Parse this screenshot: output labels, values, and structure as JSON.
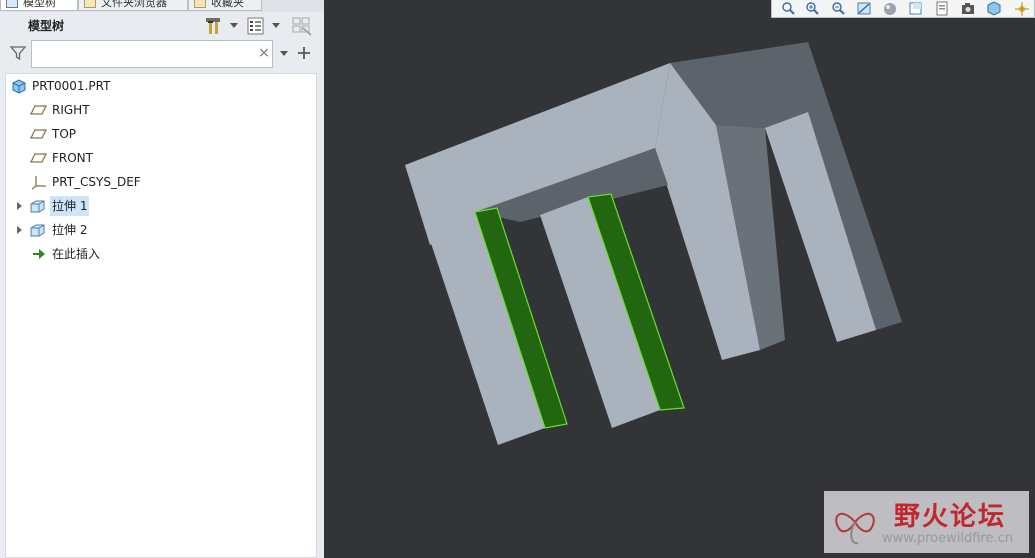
{
  "tabs": [
    {
      "label": "模型树",
      "active": true
    },
    {
      "label": "文件夹浏览器",
      "active": false
    },
    {
      "label": "收藏夹",
      "active": false
    }
  ],
  "tree_panel": {
    "title": "模型树",
    "search": {
      "value": "",
      "placeholder": ""
    },
    "clear_label": "×"
  },
  "tree": {
    "root": "PRT0001.PRT",
    "items": [
      {
        "label": "RIGHT",
        "icon": "datum-plane-icon"
      },
      {
        "label": "TOP",
        "icon": "datum-plane-icon"
      },
      {
        "label": "FRONT",
        "icon": "datum-plane-icon"
      },
      {
        "label": "PRT_CSYS_DEF",
        "icon": "coordinate-system-icon"
      },
      {
        "label": "拉伸 1",
        "icon": "extrude-icon",
        "expandable": true,
        "selected": true
      },
      {
        "label": "拉伸 2",
        "icon": "extrude-icon",
        "expandable": true
      },
      {
        "label": "在此插入",
        "icon": "insert-here-arrow-icon"
      }
    ]
  },
  "colors": {
    "viewport_bg": "#333438",
    "model_light": "#a9b2bd",
    "model_mid": "#8c949e",
    "model_dark": "#5d636b",
    "highlight": "#22660f",
    "highlight_edge": "#66e22a",
    "selection": "#cde6f7"
  },
  "watermark": {
    "title": "野火论坛",
    "url": "www.proewildfire.cn"
  }
}
